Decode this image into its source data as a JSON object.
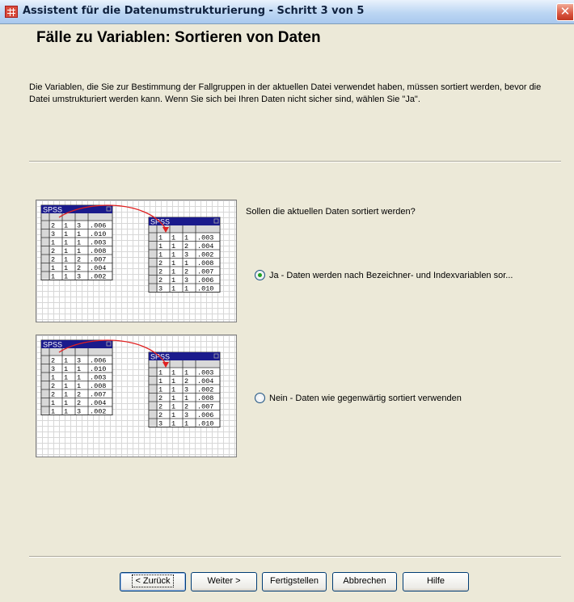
{
  "window": {
    "title": "Assistent für die Datenumstrukturierung - Schritt 3 von 5",
    "close_glyph": "✕"
  },
  "header": {
    "heading": "Fälle zu Variablen: Sortieren von Daten",
    "description": "Die Variablen, die Sie zur Bestimmung der Fallgruppen in der aktuellen Datei verwendet haben, müssen sortiert werden, bevor die Datei umstrukturiert werden kann. Wenn Sie sich bei Ihren Daten nicht sicher sind, wählen Sie \"Ja\"."
  },
  "question": "Sollen die aktuellen Daten sortiert werden?",
  "options": [
    {
      "label": "Ja - Daten werden nach Bezeichner- und Indexvariablen sor...",
      "selected": true
    },
    {
      "label": "Nein - Daten wie gegenwärtig sortiert verwenden",
      "selected": false
    }
  ],
  "illustrations": [
    {
      "source": {
        "title": "SPSS",
        "rows": [
          [
            "2",
            "1",
            "3",
            ".006"
          ],
          [
            "3",
            "1",
            "1",
            ".010"
          ],
          [
            "1",
            "1",
            "1",
            ".003"
          ],
          [
            "2",
            "1",
            "1",
            ".008"
          ],
          [
            "2",
            "1",
            "2",
            ".007"
          ],
          [
            "1",
            "1",
            "2",
            ".004"
          ],
          [
            "1",
            "1",
            "3",
            ".002"
          ]
        ]
      },
      "target": {
        "title": "SPSS",
        "rows": [
          [
            "1",
            "1",
            "1",
            ".003"
          ],
          [
            "1",
            "1",
            "2",
            ".004"
          ],
          [
            "1",
            "1",
            "3",
            ".002"
          ],
          [
            "2",
            "1",
            "1",
            ".008"
          ],
          [
            "2",
            "1",
            "2",
            ".007"
          ],
          [
            "2",
            "1",
            "3",
            ".006"
          ],
          [
            "3",
            "1",
            "1",
            ".010"
          ]
        ]
      }
    },
    {
      "source": {
        "title": "SPSS",
        "rows": [
          [
            "2",
            "1",
            "3",
            ".006"
          ],
          [
            "3",
            "1",
            "1",
            ".010"
          ],
          [
            "1",
            "1",
            "1",
            ".003"
          ],
          [
            "2",
            "1",
            "1",
            ".008"
          ],
          [
            "2",
            "1",
            "2",
            ".007"
          ],
          [
            "1",
            "1",
            "2",
            ".004"
          ],
          [
            "1",
            "1",
            "3",
            ".002"
          ]
        ]
      },
      "target": {
        "title": "SPSS",
        "rows": [
          [
            "1",
            "1",
            "1",
            ".003"
          ],
          [
            "1",
            "1",
            "2",
            ".004"
          ],
          [
            "1",
            "1",
            "3",
            ".002"
          ],
          [
            "2",
            "1",
            "1",
            ".008"
          ],
          [
            "2",
            "1",
            "2",
            ".007"
          ],
          [
            "2",
            "1",
            "3",
            ".006"
          ],
          [
            "3",
            "1",
            "1",
            ".010"
          ]
        ]
      }
    }
  ],
  "buttons": {
    "back": "< Zurück",
    "next": "Weiter >",
    "finish": "Fertigstellen",
    "cancel": "Abbrechen",
    "help": "Hilfe"
  },
  "colors": {
    "spss_titlebar": "#1a1a8c",
    "arrow": "#e02020",
    "radio_selected": "#21a121"
  }
}
